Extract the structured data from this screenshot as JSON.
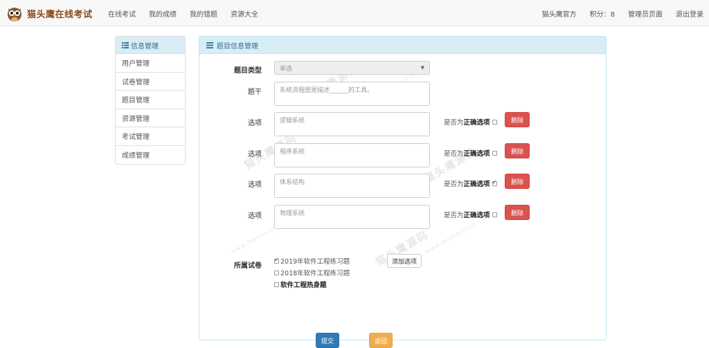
{
  "navbar": {
    "brand": "猫头鹰在线考试",
    "links": [
      "在线考试",
      "我的成绩",
      "我的错题",
      "资源大全"
    ],
    "right": {
      "user": "猫头鹰官方",
      "points_label": "积分：8",
      "admin": "管理员页面",
      "logout": "退出登录"
    }
  },
  "sidebar": {
    "title": "信息管理",
    "items": [
      "用户管理",
      "试卷管理",
      "题目管理",
      "资源管理",
      "考试管理",
      "成绩管理"
    ]
  },
  "panel": {
    "title": "题目信息管理",
    "type_label": "题目类型",
    "type_value": "单选",
    "stem_label": "题干",
    "stem_value": "系统流程图是描述______的工具。",
    "option_label": "选项",
    "correct_prefix": "是否为",
    "correct_bold": "正确选项",
    "delete_label": "删除",
    "options": [
      {
        "text": "逻辑系统",
        "correct": false
      },
      {
        "text": "程序系统",
        "correct": false
      },
      {
        "text": "体系结构",
        "correct": true
      },
      {
        "text": "物理系统",
        "correct": false
      }
    ],
    "add_option_label": "添加选项",
    "paper_label": "所属试卷",
    "papers": [
      {
        "name": "2019年软件工程练习题",
        "checked": true,
        "bold": false
      },
      {
        "name": "2018年软件工程练习题",
        "checked": false,
        "bold": false
      },
      {
        "name": "软件工程热身题",
        "checked": false,
        "bold": true
      }
    ],
    "submit_label": "提交",
    "back_label": "返回"
  },
  "watermark": {
    "text": "猫头鹰源码",
    "url": "www.maotouying.com"
  },
  "colors": {
    "panel_head_bg": "#d9edf7",
    "panel_head_text": "#31708f",
    "danger": "#d9534f",
    "primary": "#337ab7",
    "warning": "#f0ad4e"
  },
  "icons": {
    "brand": "owl-logo-icon",
    "sidebar_head": "list-icon",
    "panel_head": "menu-lines-icon",
    "select": "caret-down-icon"
  }
}
